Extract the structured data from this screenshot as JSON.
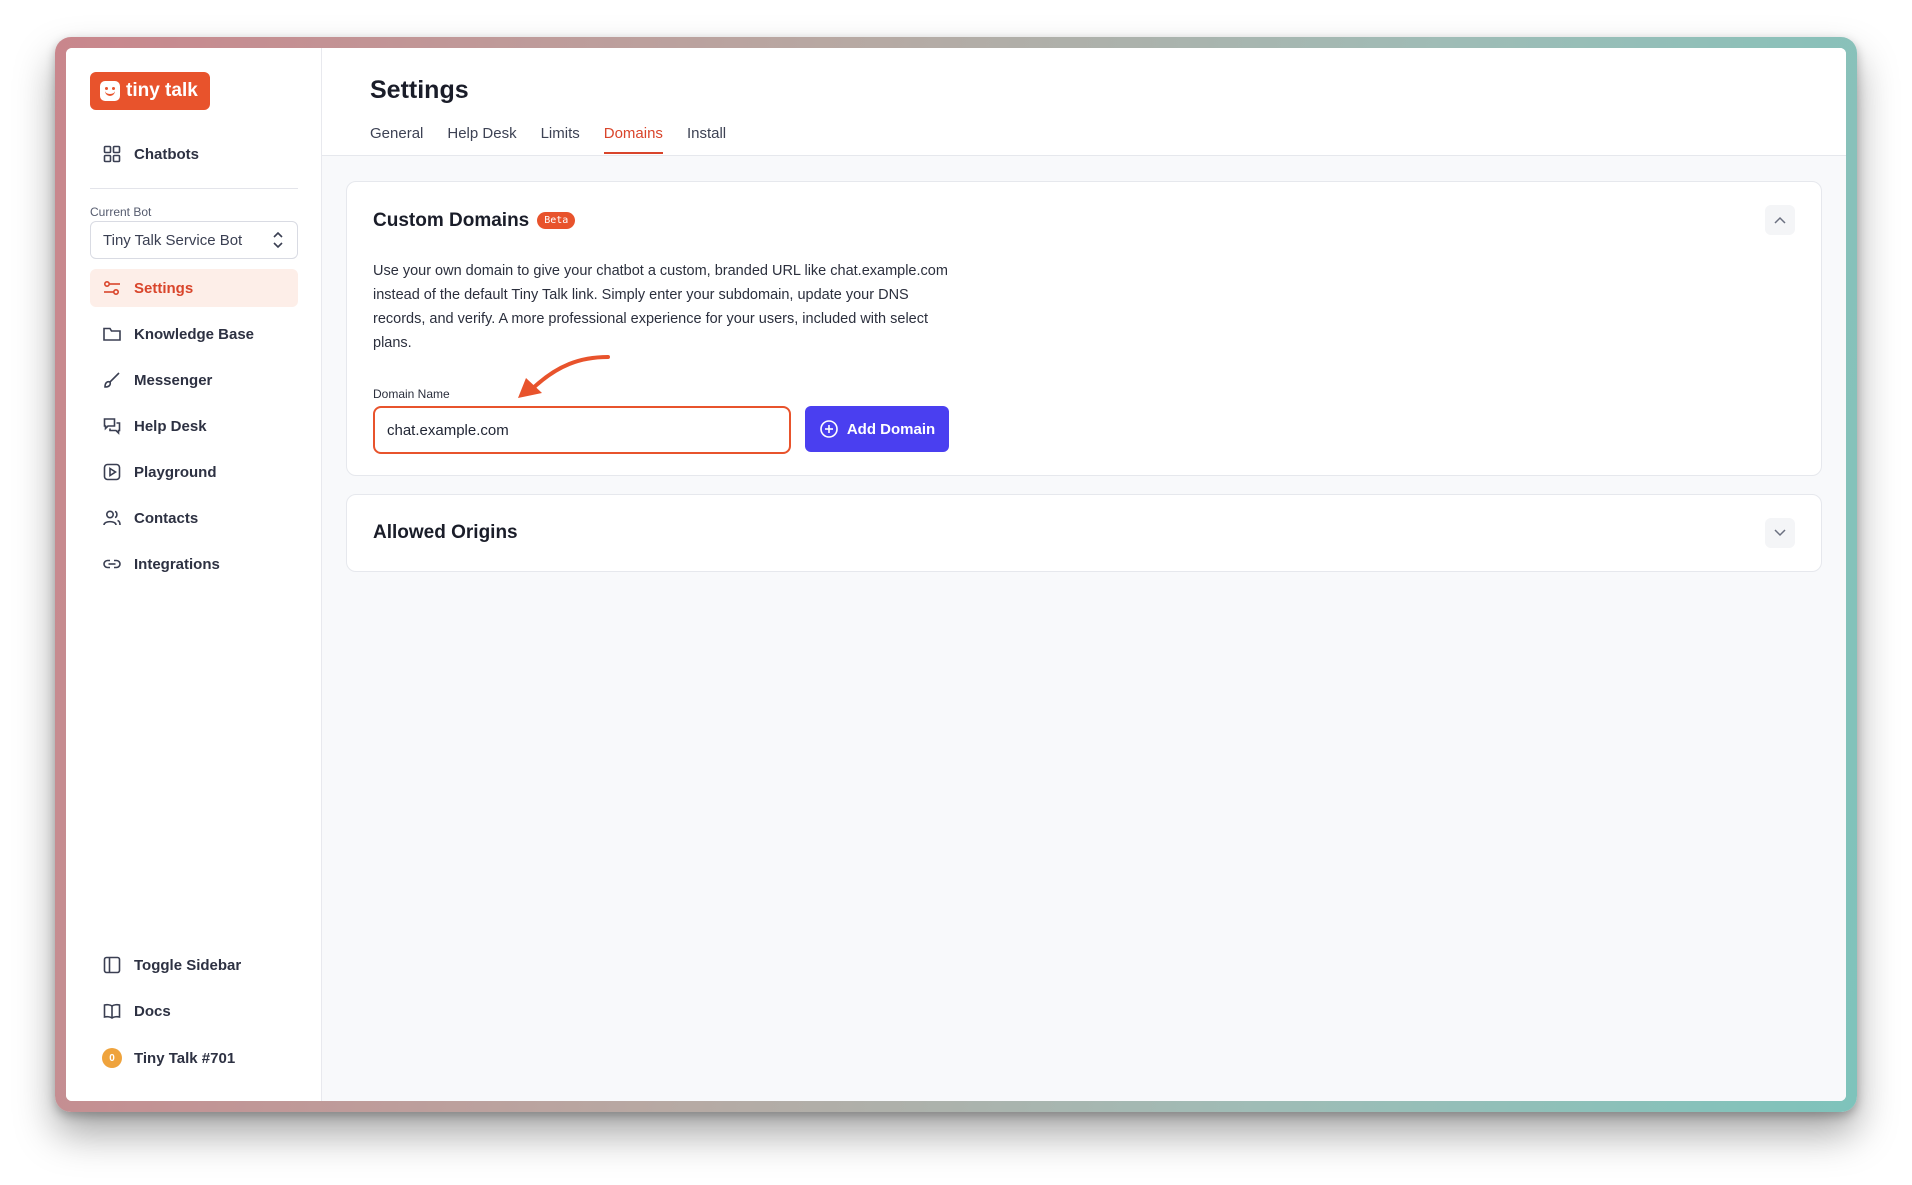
{
  "app": {
    "logo_text": "tiny talk"
  },
  "sidebar": {
    "top_item": {
      "label": "Chatbots",
      "icon": "grid-icon"
    },
    "current_bot_label": "Current Bot",
    "current_bot_value": "Tiny Talk Service Bot",
    "items": [
      {
        "label": "Settings",
        "icon": "sliders-icon",
        "active": true
      },
      {
        "label": "Knowledge Base",
        "icon": "folder-icon"
      },
      {
        "label": "Messenger",
        "icon": "brush-icon"
      },
      {
        "label": "Help Desk",
        "icon": "chat-bubbles-icon"
      },
      {
        "label": "Playground",
        "icon": "play-icon"
      },
      {
        "label": "Contacts",
        "icon": "users-icon"
      },
      {
        "label": "Integrations",
        "icon": "link-icon"
      }
    ],
    "bottom": {
      "toggle_sidebar": "Toggle Sidebar",
      "docs": "Docs",
      "account_name": "Tiny Talk #701",
      "account_badge": "0"
    }
  },
  "header": {
    "title": "Settings",
    "tabs": [
      {
        "label": "General"
      },
      {
        "label": "Help Desk"
      },
      {
        "label": "Limits"
      },
      {
        "label": "Domains",
        "active": true
      },
      {
        "label": "Install"
      }
    ]
  },
  "custom_domains": {
    "title": "Custom Domains",
    "badge": "Beta",
    "description": "Use your own domain to give your chatbot a custom, branded URL like chat.example.com instead of the default Tiny Talk link. Simply enter your subdomain, update your DNS records, and verify. A more professional experience for your users, included with select plans.",
    "field_label": "Domain Name",
    "field_value": "chat.example.com",
    "add_button": "Add Domain"
  },
  "allowed_origins": {
    "title": "Allowed Origins"
  },
  "colors": {
    "accent": "#e8532c",
    "primary_button": "#4a3ff0",
    "active_nav_bg": "#fdeee8"
  }
}
